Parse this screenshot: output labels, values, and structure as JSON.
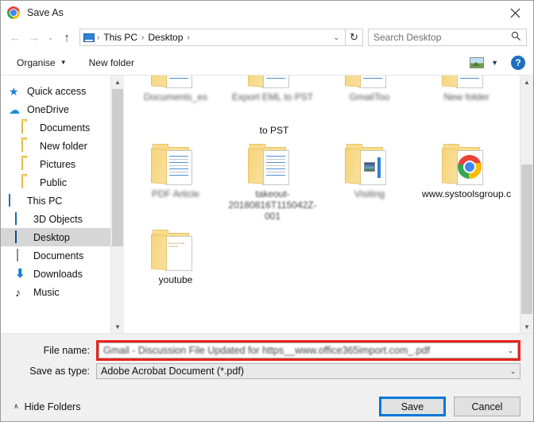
{
  "window": {
    "title": "Save As",
    "app_icon": "chrome-icon",
    "close_label": "✕"
  },
  "nav": {
    "back": "←",
    "forward": "→",
    "recent": "⌄",
    "up": "↑",
    "refresh": "↻",
    "dropdown": "⌄",
    "breadcrumbs": [
      "This PC",
      "Desktop"
    ],
    "separator": "›",
    "trailing_separator": "›"
  },
  "search": {
    "placeholder": "Search Desktop",
    "icon": "search-icon"
  },
  "toolbar": {
    "organise_label": "Organise",
    "organise_caret": "▼",
    "new_folder_label": "New folder",
    "view_caret": "▼",
    "help_label": "?"
  },
  "sidebar": {
    "items": [
      {
        "label": "Quick access",
        "icon": "star-icon",
        "level": 0,
        "selected": false
      },
      {
        "label": "OneDrive",
        "icon": "cloud-icon",
        "level": 0,
        "selected": false
      },
      {
        "label": "Documents",
        "icon": "folder-icon",
        "level": 1,
        "selected": false
      },
      {
        "label": "New folder",
        "icon": "folder-icon",
        "level": 1,
        "selected": false
      },
      {
        "label": "Pictures",
        "icon": "folder-icon",
        "level": 1,
        "selected": false
      },
      {
        "label": "Public",
        "icon": "folder-icon",
        "level": 1,
        "selected": false
      },
      {
        "label": "This PC",
        "icon": "monitor-icon",
        "level": 0,
        "selected": false
      },
      {
        "label": "3D Objects",
        "icon": "cube-icon",
        "level": 1,
        "selected": false
      },
      {
        "label": "Desktop",
        "icon": "desktop-icon",
        "level": 1,
        "selected": true
      },
      {
        "label": "Documents",
        "icon": "document-icon",
        "level": 1,
        "selected": false
      },
      {
        "label": "Downloads",
        "icon": "download-icon",
        "level": 1,
        "selected": false
      },
      {
        "label": "Music",
        "icon": "music-icon",
        "level": 1,
        "selected": false
      }
    ]
  },
  "files": {
    "row1": [
      {
        "label": "Documents_es",
        "blurred": true
      },
      {
        "label": "Export EML to PST",
        "blurred": true,
        "visible_part": "to PST"
      },
      {
        "label": "GmailToo",
        "blurred": true
      },
      {
        "label": "New folder",
        "blurred": true
      }
    ],
    "row2": [
      {
        "label": "PDF Article",
        "blurred": true
      },
      {
        "label": "takeout-20180816T115042Z-001",
        "blurred": true,
        "visible_part": "T115042Z-001"
      },
      {
        "label": "Visiting",
        "blurred": true
      },
      {
        "label": "www.systoolsgroup.c",
        "blurred": false
      }
    ],
    "row3": [
      {
        "label": "youtube",
        "blurred": false
      }
    ]
  },
  "form": {
    "file_name_label": "File name:",
    "file_name_value": "Gmail - Discussion File Updated for https__www.office365import.com_.pdf",
    "save_as_type_label": "Save as type:",
    "save_as_type_value": "Adobe Acrobat Document (*.pdf)",
    "caret": "⌄",
    "highlight_color": "#e8231f"
  },
  "footer": {
    "hide_folders_label": "Hide Folders",
    "hide_folders_caret": "∧",
    "save_label": "Save",
    "cancel_label": "Cancel",
    "focus_color": "#0078d7"
  }
}
